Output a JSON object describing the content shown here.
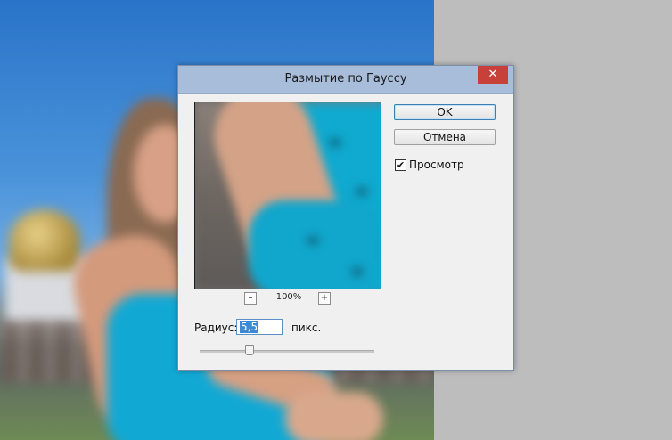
{
  "dialog": {
    "title": "Размытие по Гауссу",
    "close_symbol": "✕",
    "ok_label": "OK",
    "cancel_label": "Отмена",
    "preview_label": "Просмотр",
    "preview_checked": true,
    "check_symbol": "✔",
    "zoom": {
      "minus": "–",
      "plus": "+",
      "level": "100%"
    },
    "radius": {
      "label": "Радиус:",
      "value": "5,5",
      "unit": "пикс.",
      "slider_fraction": 0.28
    }
  },
  "colors": {
    "close_button": "#c7403a",
    "titlebar": "#a7bdda",
    "selection": "#3b89d6"
  }
}
